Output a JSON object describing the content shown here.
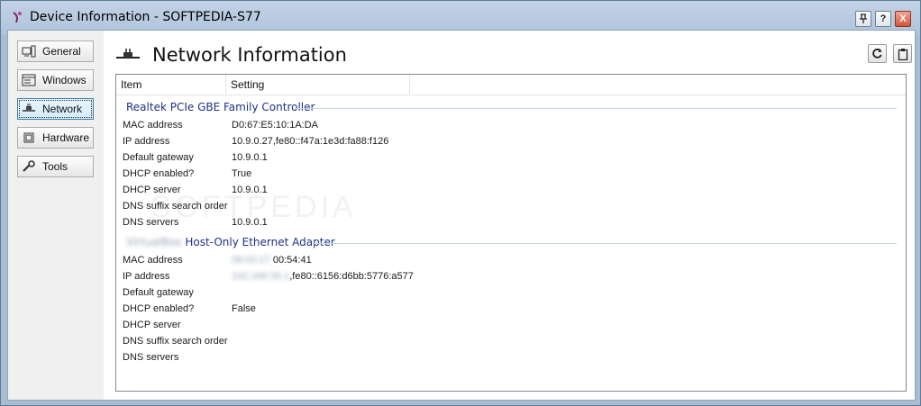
{
  "window": {
    "title": "Device Information - SOFTPEDIA-S77",
    "buttons": {
      "pin": "†",
      "help": "?",
      "close": "X"
    }
  },
  "sidebar": {
    "items": [
      {
        "label": "General",
        "icon": "computer-icon"
      },
      {
        "label": "Windows",
        "icon": "window-icon"
      },
      {
        "label": "Network",
        "icon": "network-icon",
        "active": true
      },
      {
        "label": "Hardware",
        "icon": "chip-icon"
      },
      {
        "label": "Tools",
        "icon": "wrench-icon"
      }
    ]
  },
  "header": {
    "title": "Network Information",
    "icon": "network-icon"
  },
  "columns": [
    "Item",
    "Setting"
  ],
  "groups": [
    {
      "name": "Realtek PCIe GBE Family Controller",
      "name_prefix_blurred": "",
      "rows": [
        {
          "item": "MAC address",
          "value": "D0:67:E5:10:1A:DA",
          "blurred": ""
        },
        {
          "item": "IP address",
          "value": "10.9.0.27,fe80::f47a:1e3d:fa88:f126",
          "blurred": ""
        },
        {
          "item": "Default gateway",
          "value": "10.9.0.1",
          "blurred": ""
        },
        {
          "item": "DHCP enabled?",
          "value": "True",
          "blurred": ""
        },
        {
          "item": "DHCP server",
          "value": "10.9.0.1",
          "blurred": ""
        },
        {
          "item": "DNS suffix search order",
          "value": "",
          "blurred": ""
        },
        {
          "item": "DNS servers",
          "value": "10.9.0.1",
          "blurred": ""
        }
      ]
    },
    {
      "name": "Host-Only Ethernet Adapter",
      "name_prefix_blurred": "VirtualBox",
      "rows": [
        {
          "item": "MAC address",
          "value": "00:54:41",
          "blurred": "08:00:27:"
        },
        {
          "item": "IP address",
          "value": ",fe80::6156:d6bb:5776:a577",
          "blurred": "192.168.56.1"
        },
        {
          "item": "Default gateway",
          "value": "",
          "blurred": ""
        },
        {
          "item": "DHCP enabled?",
          "value": "False",
          "blurred": ""
        },
        {
          "item": "DHCP server",
          "value": "",
          "blurred": ""
        },
        {
          "item": "DNS suffix search order",
          "value": "",
          "blurred": ""
        },
        {
          "item": "DNS servers",
          "value": "",
          "blurred": ""
        }
      ]
    }
  ],
  "colors": {
    "group_title": "#1e3287",
    "frame": "#a9bcd1",
    "group_line": "#c6d7e9"
  }
}
